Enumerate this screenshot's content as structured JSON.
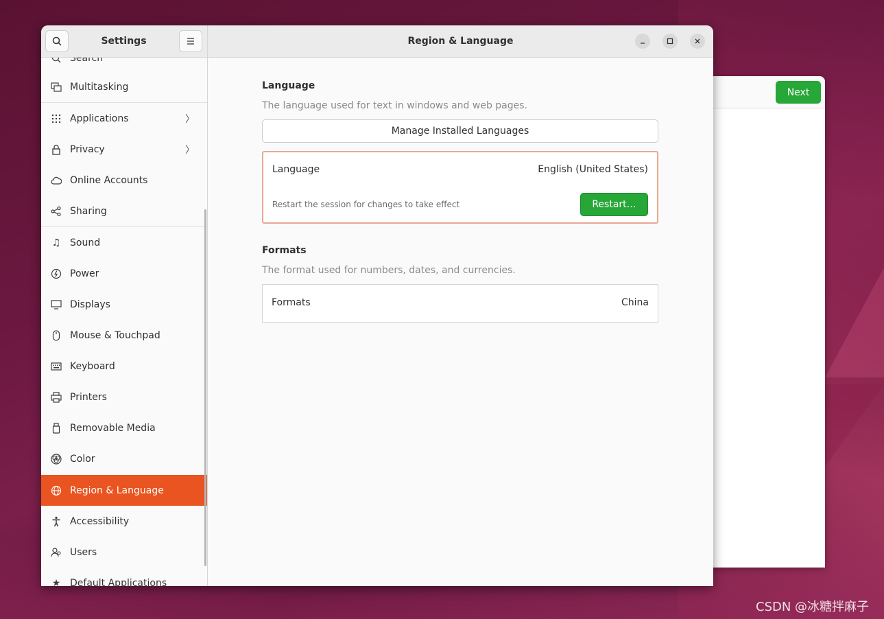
{
  "background_window": {
    "next_label": "Next"
  },
  "header": {
    "settings_title": "Settings",
    "page_title": "Region & Language"
  },
  "sidebar": {
    "partial_top_label": "Search",
    "items": [
      {
        "label": "Multitasking",
        "icon": "multitasking-icon"
      },
      {
        "label": "Applications",
        "icon": "grid-icon",
        "chevron": true
      },
      {
        "label": "Privacy",
        "icon": "lock-icon",
        "chevron": true
      },
      {
        "label": "Online Accounts",
        "icon": "cloud-icon"
      },
      {
        "label": "Sharing",
        "icon": "share-icon"
      },
      {
        "label": "Sound",
        "icon": "music-note-icon"
      },
      {
        "label": "Power",
        "icon": "power-icon"
      },
      {
        "label": "Displays",
        "icon": "display-icon"
      },
      {
        "label": "Mouse & Touchpad",
        "icon": "mouse-icon"
      },
      {
        "label": "Keyboard",
        "icon": "keyboard-icon"
      },
      {
        "label": "Printers",
        "icon": "printer-icon"
      },
      {
        "label": "Removable Media",
        "icon": "usb-icon"
      },
      {
        "label": "Color",
        "icon": "color-icon"
      },
      {
        "label": "Region & Language",
        "icon": "globe-icon",
        "active": true
      },
      {
        "label": "Accessibility",
        "icon": "accessibility-icon"
      },
      {
        "label": "Users",
        "icon": "users-icon"
      },
      {
        "label": "Default Applications",
        "icon": "star-icon"
      }
    ]
  },
  "language_section": {
    "title": "Language",
    "description": "The language used for text in windows and web pages.",
    "manage_button": "Manage Installed Languages",
    "row_label": "Language",
    "row_value": "English (United States)",
    "restart_note": "Restart the session for changes to take effect",
    "restart_button": "Restart…"
  },
  "formats_section": {
    "title": "Formats",
    "description": "The format used for numbers, dates, and currencies.",
    "row_label": "Formats",
    "row_value": "China"
  },
  "watermark": "CSDN @冰糖拌麻子",
  "colors": {
    "accent": "#e95420",
    "success": "#26a737",
    "highlight_border": "#e8a893"
  }
}
